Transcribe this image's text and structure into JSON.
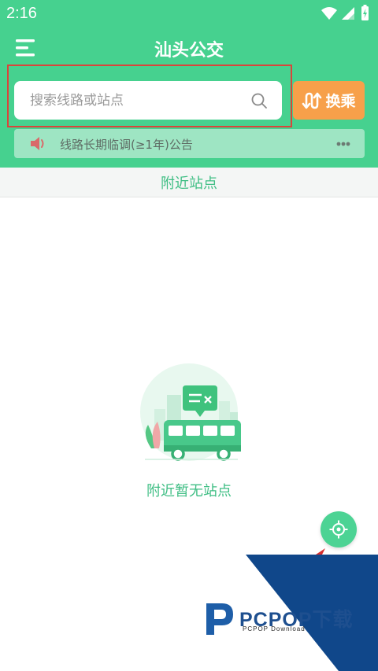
{
  "status_bar": {
    "time": "2:16"
  },
  "header": {
    "title": "汕头公交",
    "menu_icon": "hamburger-menu-icon"
  },
  "search": {
    "placeholder": "搜索线路或站点",
    "value": ""
  },
  "transfer_button": {
    "label": "换乘",
    "icon": "transfer-arrows-icon"
  },
  "notice": {
    "text": "线路长期临调(≥1年)公告",
    "icon": "speaker-icon"
  },
  "nearby": {
    "title": "附近站点",
    "empty_text": "附近暂无站点"
  },
  "watermark": {
    "brand": "PCPOP下载",
    "sub": "PCPOP Download"
  },
  "colors": {
    "header_green": "#46d18f",
    "accent_orange": "#f7a04a",
    "text_green": "#3fbe84",
    "notice_bg": "#9ee5c3"
  }
}
